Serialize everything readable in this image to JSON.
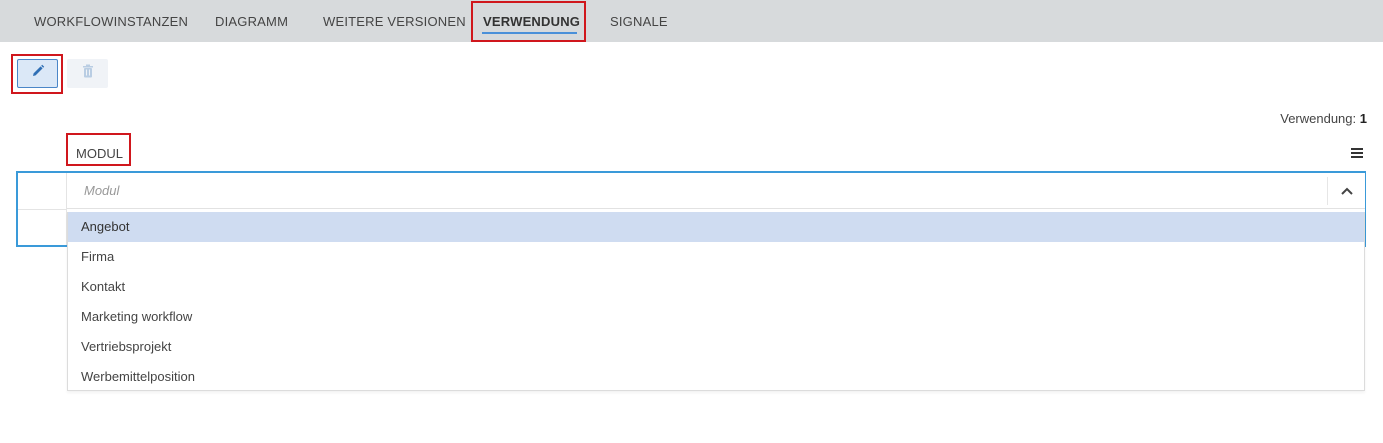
{
  "tabs": [
    {
      "label": "WORKFLOWINSTANZEN",
      "active": false
    },
    {
      "label": "DIAGRAMM",
      "active": false
    },
    {
      "label": "WEITERE VERSIONEN",
      "active": false
    },
    {
      "label": "VERWENDUNG",
      "active": true
    },
    {
      "label": "SIGNALE",
      "active": false
    }
  ],
  "toolbar": {
    "edit_icon": "pencil-icon",
    "delete_icon": "trash-icon"
  },
  "usage": {
    "label": "Verwendung:",
    "count": "1"
  },
  "table": {
    "column_header": "MODUL",
    "menu_icon": "hamburger-menu-icon"
  },
  "select": {
    "placeholder": "Modul",
    "arrow_icon": "chevron-up-icon",
    "options": [
      "Angebot",
      "Firma",
      "Kontakt",
      "Marketing workflow",
      "Vertriebsprojekt",
      "Werbemittelposition"
    ],
    "highlighted": "Angebot"
  },
  "colors": {
    "tabbar_bg": "#d7dadc",
    "accent": "#4a90d9",
    "table_border": "#3a9ad9",
    "option_highlight": "#cfdcf1",
    "annotation_red": "#d0171d"
  }
}
